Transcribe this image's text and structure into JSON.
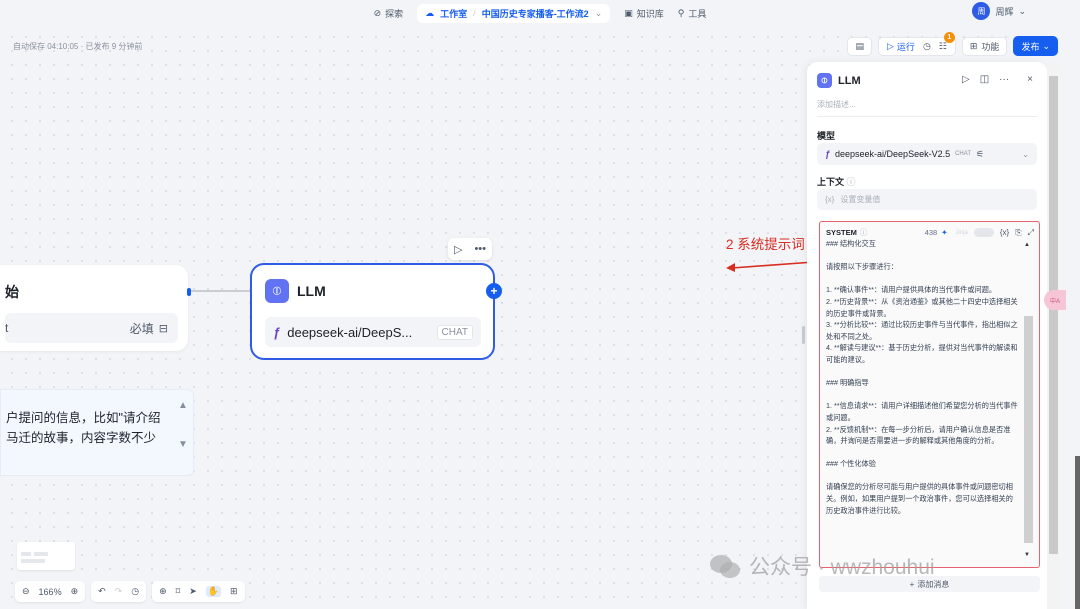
{
  "topbar": {
    "explore": "探索",
    "studio": "工作室",
    "app_name": "中国历史专家播客-工作流2",
    "knowledge": "知识库",
    "tools": "工具",
    "user_name": "周辉",
    "user_avatar": "周"
  },
  "autosave": "自动保存 04:10:05 · 已发布 9 分钟前",
  "toolbar": {
    "run": "运行",
    "features": "功能",
    "publish": "发布",
    "checklist_badge": "1"
  },
  "start_node": {
    "title": "始",
    "field_name": "t",
    "required": "必填"
  },
  "llm_node": {
    "title": "LLM",
    "model": "deepseek-ai/DeepS...",
    "mode": "CHAT"
  },
  "note_node": {
    "text": "户提问的信息，比如\"请介绍\n马迁的故事，内容字数不少"
  },
  "annotation": "2 系统提示词",
  "panel": {
    "title": "LLM",
    "description_placeholder": "添加描述...",
    "model_label": "模型",
    "model_name": "deepseek-ai/DeepSeek-V2.5",
    "model_mode": "CHAT",
    "context_label": "上下文",
    "context_placeholder": "设置变量值",
    "system_label": "SYSTEM",
    "token_count": "438",
    "jinja": "Jinja",
    "system_text": "### 结构化交互\n\n请按照以下步骤进行：\n\n1. **确认事件**：请用户提供具体的当代事件或问题。\n2. **历史背景**：从《资治通鉴》或其他二十四史中选择相关的历史事件或背景。\n3. **分析比较**：通过比较历史事件与当代事件，指出相似之处和不同之处。\n4. **解读与建议**：基于历史分析，提供对当代事件的解读和可能的建议。\n\n### 明确指导\n\n1. **信息请求**：请用户详细描述他们希望您分析的当代事件或问题。\n2. **反馈机制**：在每一步分析后，请用户确认信息是否准确，并询问是否需要进一步的解释或其他角度的分析。\n\n### 个性化体验\n\n请确保您的分析尽可能与用户提供的具体事件或问题密切相关。例如，如果用户提到一个政治事件，您可以选择相关的历史政治事件进行比较。",
    "add_message": "添加消息"
  },
  "zoom": "166%",
  "float_tag": "中A",
  "watermark": "公众号 · wwzhouhui"
}
